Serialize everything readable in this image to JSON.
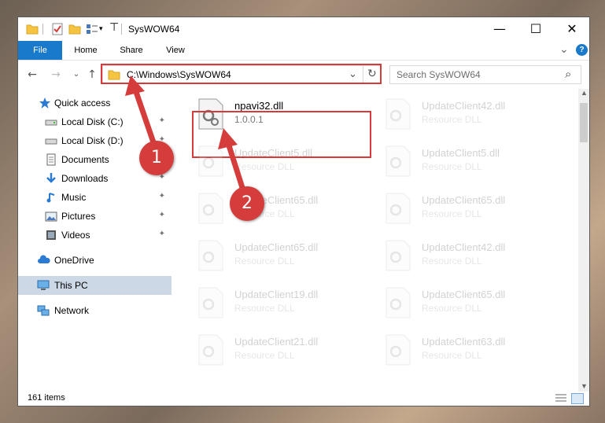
{
  "window": {
    "title": "SysWOW64",
    "min_glyph": "—",
    "max_glyph": "☐",
    "close_glyph": "✕"
  },
  "ribbon": {
    "tabs": [
      "File",
      "Home",
      "Share",
      "View"
    ],
    "expand_glyph": "⌄",
    "help_glyph": "?"
  },
  "nav": {
    "back": "←",
    "forward": "→",
    "recent": "⌄",
    "up": "↑",
    "address": "C:\\Windows\\SysWOW64",
    "address_dropdown": "⌄",
    "refresh": "↻",
    "search_placeholder": "Search SysWOW64",
    "search_glyph": "⌕"
  },
  "sidebar": {
    "quick_access": "Quick access",
    "items": [
      {
        "label": "Local Disk (C:)",
        "icon": "drive-icon",
        "pinned": true
      },
      {
        "label": "Local Disk (D:)",
        "icon": "drive-icon",
        "pinned": true
      },
      {
        "label": "Documents",
        "icon": "documents-icon",
        "pinned": true
      },
      {
        "label": "Downloads",
        "icon": "downloads-icon",
        "pinned": true
      },
      {
        "label": "Music",
        "icon": "music-icon",
        "pinned": true
      },
      {
        "label": "Pictures",
        "icon": "pictures-icon",
        "pinned": true
      },
      {
        "label": "Videos",
        "icon": "videos-icon",
        "pinned": true
      }
    ],
    "onedrive": "OneDrive",
    "thispc": "This PC",
    "network": "Network",
    "pin_glyph": "📌"
  },
  "files": {
    "highlight": {
      "name": "npavi32.dll",
      "desc": "1.0.0.1"
    },
    "left_column": [
      {
        "name": "UpdateClient5.dll",
        "desc": "Resource DLL"
      },
      {
        "name": "UpdateClient65.dll",
        "desc": "Resource DLL"
      },
      {
        "name": "UpdateClient65.dll",
        "desc": "Resource DLL"
      },
      {
        "name": "UpdateClient19.dll",
        "desc": "Resource DLL"
      },
      {
        "name": "UpdateClient21.dll",
        "desc": "Resource DLL"
      }
    ],
    "right_column": [
      {
        "name": "UpdateClient42.dll",
        "desc": "Resource DLL"
      },
      {
        "name": "UpdateClient5.dll",
        "desc": "Resource DLL"
      },
      {
        "name": "UpdateClient65.dll",
        "desc": "Resource DLL"
      },
      {
        "name": "UpdateClient42.dll",
        "desc": "Resource DLL"
      },
      {
        "name": "UpdateClient65.dll",
        "desc": "Resource DLL"
      },
      {
        "name": "UpdateClient63.dll",
        "desc": "Resource DLL"
      }
    ]
  },
  "status": {
    "count": "161 items"
  },
  "annotations": {
    "marker1": "1",
    "marker2": "2",
    "color": "#d43d3c"
  }
}
